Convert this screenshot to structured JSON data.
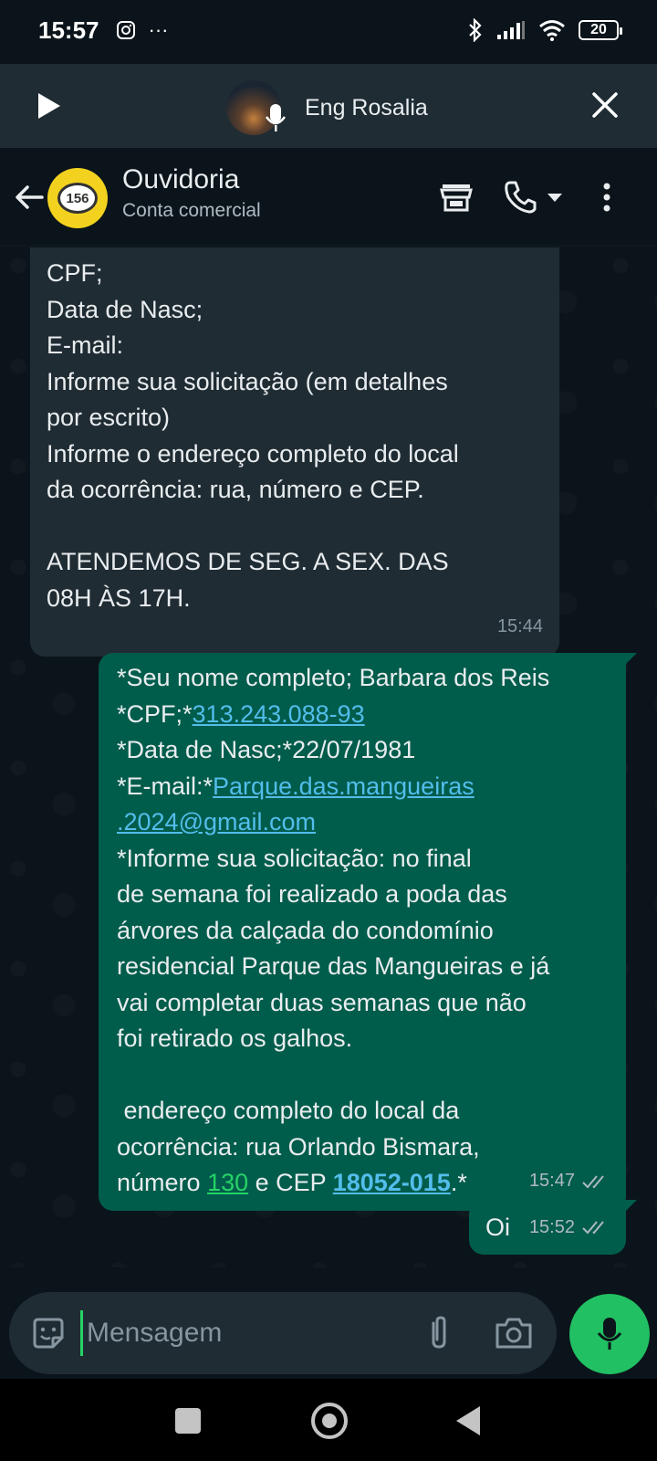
{
  "status_bar": {
    "time": "15:57",
    "left_icons": [
      "instagram-icon",
      "more-dots-icon"
    ],
    "more_dots": "···",
    "right_icons": [
      "bluetooth-icon",
      "signal-icon",
      "wifi-icon",
      "battery-icon"
    ],
    "battery": "20"
  },
  "call_strip": {
    "name": "Eng Rosalia"
  },
  "header": {
    "title": "Ouvidoria",
    "subtitle": "Conta comercial",
    "avatar_text": "156"
  },
  "messages": {
    "incoming": {
      "lines": [
        "CPF;",
        "Data de Nasc;",
        "E-mail:",
        "Informe sua solicitação (em detalhes",
        "por escrito)",
        "Informe o endereço completo do local",
        "da ocorrência: rua, número e CEP.",
        "",
        "ATENDEMOS DE SEG. A SEX. DAS",
        "08H ÀS 17H."
      ],
      "time": "15:44"
    },
    "outgoing": {
      "line1": "*Seu nome completo; Barbara dos Reis",
      "line2_prefix": "*CPF;*",
      "cpf": "313.243.088-93",
      "line3": "*Data de Nasc;*22/07/1981",
      "line4_prefix": "*E-mail:*",
      "email_part1": "Parque.das.mangueiras",
      "email_part2": ".2024@gmail.com",
      "line6": "*Informe sua solicitação: no final",
      "line7": "de semana foi realizado a poda das",
      "line8": "árvores da calçada do condomínio",
      "line9": "residencial Parque das Mangueiras e já",
      "line10": "vai completar duas semanas que não",
      "line11": "foi retirado os galhos.",
      "line13": " endereço completo do local da",
      "line14": "ocorrência: rua Orlando Bismara,",
      "line15_prefix": "número ",
      "number": "130",
      "line15_mid": " e CEP ",
      "cep": "18052-015",
      "line15_suffix": ".*",
      "time": "15:47"
    },
    "oi": {
      "text": "Oi",
      "time": "15:52"
    }
  },
  "input": {
    "placeholder": "Mensagem"
  },
  "colors": {
    "background": "#0b141a",
    "incoming_bubble": "#202c33",
    "outgoing_bubble": "#005c4b",
    "link": "#53bdeb",
    "accent_green": "#21c063"
  }
}
